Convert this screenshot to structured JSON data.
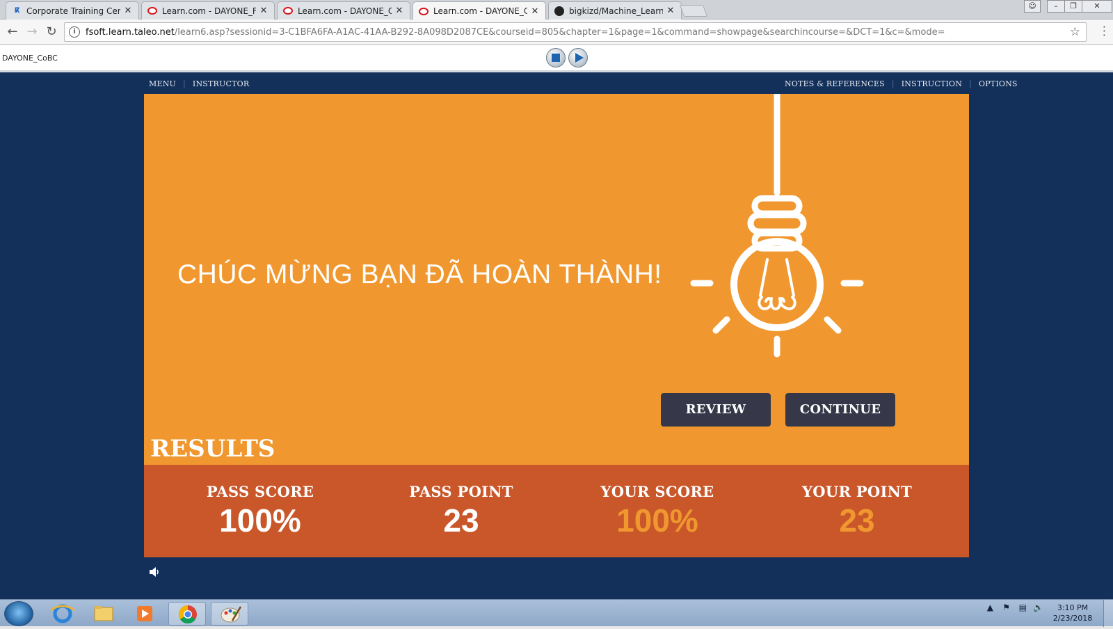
{
  "browser": {
    "tabs": [
      {
        "title": "Corporate Training Cente",
        "icon": "corporate-favicon"
      },
      {
        "title": "Learn.com - DAYONE_FW",
        "icon": "oracle-favicon"
      },
      {
        "title": "Learn.com - DAYONE_QI",
        "icon": "oracle-favicon"
      },
      {
        "title": "Learn.com - DAYONE_Co",
        "icon": "oracle-favicon",
        "active": true
      },
      {
        "title": "bigkizd/Machine_Learnin",
        "icon": "github-favicon"
      }
    ],
    "close_glyph": "✕",
    "url_host": "fsoft.learn.taleo.net",
    "url_path": "/learn6.asp?sessionid=3-C1BFA6FA-A1AC-41AA-B292-8A098D2087CE&courseid=805&chapter=1&page=1&command=showpage&searchincourse=&DCT=1&c=&mode="
  },
  "player": {
    "course_code": "DAYONE_CoBC"
  },
  "nav": {
    "left": [
      "MENU",
      "INSTRUCTOR"
    ],
    "right": [
      "NOTES & REFERENCES",
      "INSTRUCTION",
      "OPTIONS"
    ]
  },
  "content": {
    "headline": "CHÚC MỪNG BẠN ĐÃ HOÀN THÀNH!",
    "review_label": "REVIEW",
    "continue_label": "CONTINUE",
    "results_title": "RESULTS",
    "stats": [
      {
        "label": "PASS SCORE",
        "value": "100%",
        "color": "#ffffff"
      },
      {
        "label": "PASS POINT",
        "value": "23",
        "color": "#ffffff"
      },
      {
        "label": "YOUR SCORE",
        "value": "100%",
        "color": "#f0982f"
      },
      {
        "label": "YOUR POINT",
        "value": "23",
        "color": "#f0982f"
      }
    ]
  },
  "colors": {
    "stage_bg": "#13305a",
    "card_orange": "#f0982f",
    "results_band": "#c9572a",
    "button_dark": "#363849"
  },
  "taskbar": {
    "time": "3:10 PM",
    "date": "2/23/2018"
  }
}
